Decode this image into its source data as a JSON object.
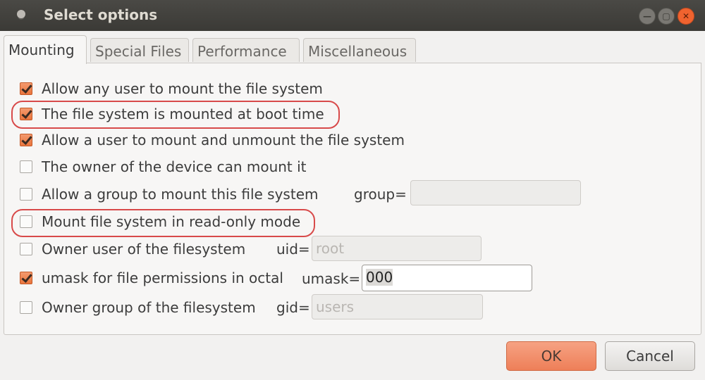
{
  "window": {
    "title": "Select options"
  },
  "tabs": [
    {
      "label": "Mounting",
      "active": true
    },
    {
      "label": "Special Files",
      "active": false
    },
    {
      "label": "Performance",
      "active": false
    },
    {
      "label": "Miscellaneous",
      "active": false
    }
  ],
  "options": [
    {
      "label": "Allow any user to mount the file system",
      "checked": true
    },
    {
      "label": "The file system is mounted at boot time",
      "checked": true,
      "highlighted": true
    },
    {
      "label": "Allow a user to mount and unmount the file system",
      "checked": true
    },
    {
      "label": "The owner of the device can mount it",
      "checked": false
    },
    {
      "label": "Allow a group to mount this file system",
      "checked": false
    },
    {
      "label": "Mount file system in read-only mode",
      "checked": false,
      "highlighted": true
    },
    {
      "label": "Owner user of the filesystem",
      "checked": false
    },
    {
      "label": "umask for file permissions in octal",
      "checked": true
    },
    {
      "label": "Owner group of the filesystem",
      "checked": false
    }
  ],
  "fields": {
    "group": {
      "label": "group=",
      "value": "",
      "enabled": false
    },
    "uid": {
      "label": "uid=",
      "value": "root",
      "enabled": false
    },
    "umask": {
      "label": "umask=",
      "value": "000",
      "enabled": true
    },
    "gid": {
      "label": "gid=",
      "value": "users",
      "enabled": false
    }
  },
  "buttons": {
    "ok": "OK",
    "cancel": "Cancel"
  },
  "colors": {
    "accent": "#ee7f58",
    "highlight": "#d84a4a",
    "close": "#f0632f"
  }
}
